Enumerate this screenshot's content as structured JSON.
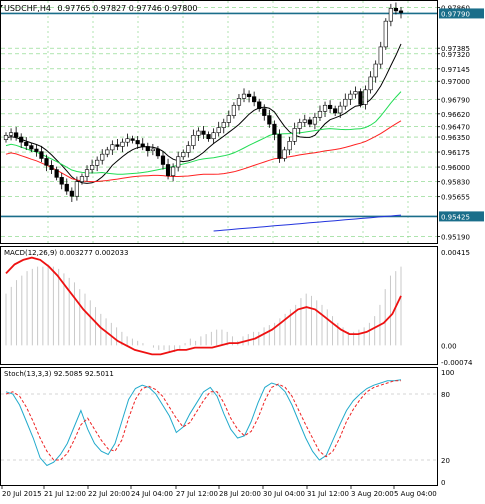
{
  "header": {
    "symbol_timeframe": "USDCHF,H4",
    "ohlc": "0.97765 0.97827 0.97746 0.97800"
  },
  "price_axis": {
    "ticks": [
      "0.97860",
      "0.97790",
      "0.97385",
      "0.97320",
      "0.97145",
      "0.97000",
      "0.96790",
      "0.96620",
      "0.96470",
      "0.96350",
      "0.96175",
      "0.96000",
      "0.95830",
      "0.95655",
      "0.95425",
      "0.95190"
    ],
    "highlighted": [
      {
        "label": "0.97790",
        "color": "#1a6e8a"
      },
      {
        "label": "0.95425",
        "color": "#1a6e8a"
      }
    ]
  },
  "macd": {
    "label": "MACD(12,26,9) 0.003277 0.002033",
    "ticks": [
      "0.00415",
      "0.00",
      "-0.00074"
    ],
    "histogram": [
      0.0023,
      0.0026,
      0.0029,
      0.0031,
      0.0033,
      0.0034,
      0.0035,
      0.0035,
      0.0036,
      0.0035,
      0.0034,
      0.0032,
      0.003,
      0.0028,
      0.0025,
      0.0023,
      0.002,
      0.0017,
      0.0014,
      0.0012,
      0.001,
      0.0008,
      0.0006,
      0.0004,
      0.0003,
      0.0002,
      0.0001,
      0.0,
      -0.0001,
      -0.0002,
      -0.0002,
      -0.0003,
      -0.0003,
      -0.0002,
      0.0001,
      0.0003,
      0.0002,
      0.0004,
      0.0005,
      0.0006,
      0.0007,
      0.0007,
      0.0006,
      0.0004,
      0.0002,
      0.0004,
      0.0005,
      0.0006,
      0.0006,
      0.0008,
      0.0009,
      0.001,
      0.0012,
      0.0014,
      0.0016,
      0.0018,
      0.0021,
      0.0023,
      0.0022,
      0.002,
      0.0018,
      0.0016,
      0.0013,
      0.001,
      0.0008,
      0.0006,
      0.0006,
      0.0007,
      0.0008,
      0.001,
      0.0013,
      0.0018,
      0.0025,
      0.0031,
      0.0033,
      0.0035
    ],
    "signal": [
      0.0032,
      0.0036,
      0.0038,
      0.0039,
      0.0038,
      0.0035,
      0.0031,
      0.0026,
      0.0021,
      0.0016,
      0.0012,
      0.0008,
      0.0005,
      0.0002,
      0.0,
      -0.0002,
      -0.0003,
      -0.0004,
      -0.0004,
      -0.0003,
      -0.0002,
      -0.0002,
      -0.0001,
      -0.0001,
      -0.0001,
      0.0,
      0.0001,
      0.0001,
      0.0002,
      0.0003,
      0.0005,
      0.0007,
      0.001,
      0.0013,
      0.0016,
      0.0017,
      0.0016,
      0.0013,
      0.001,
      0.0007,
      0.0005,
      0.0005,
      0.0006,
      0.0008,
      0.001,
      0.0014,
      0.0022
    ]
  },
  "stoch": {
    "label": "Stoch(13,3,3) 92.5085 92.5011",
    "ticks": [
      "100",
      "80",
      "20",
      "0"
    ],
    "main": [
      82,
      80,
      70,
      55,
      40,
      22,
      15,
      18,
      25,
      35,
      50,
      65,
      48,
      35,
      28,
      25,
      35,
      55,
      75,
      85,
      88,
      86,
      80,
      70,
      60,
      45,
      50,
      62,
      72,
      82,
      86,
      78,
      62,
      48,
      40,
      42,
      55,
      72,
      86,
      90,
      88,
      82,
      70,
      55,
      40,
      28,
      20,
      24,
      38,
      52,
      65,
      74,
      80,
      85,
      88,
      90,
      92,
      92,
      93
    ],
    "signal": [
      80,
      82,
      78,
      68,
      55,
      40,
      28,
      20,
      20,
      26,
      38,
      52,
      58,
      48,
      38,
      30,
      28,
      38,
      58,
      75,
      85,
      87,
      84,
      78,
      68,
      58,
      50,
      54,
      64,
      74,
      82,
      82,
      72,
      58,
      48,
      42,
      46,
      58,
      74,
      86,
      89,
      86,
      78,
      65,
      52,
      40,
      28,
      23,
      28,
      40,
      55,
      66,
      75,
      82,
      86,
      88,
      90,
      92,
      92
    ]
  },
  "time_axis": {
    "labels": [
      "20 Jul 2015",
      "21 Jul 12:00",
      "22 Jul 20:00",
      "24 Jul 04:00",
      "27 Jul 12:00",
      "28 Jul 20:00",
      "30 Jul 04:00",
      "31 Jul 12:00",
      "3 Aug 20:00",
      "5 Aug 04:00"
    ]
  },
  "colors": {
    "bull": "#ffffff",
    "bear": "#000000",
    "ma_fast": "#000000",
    "ma_mid": "#22dd55",
    "ma_slow": "#ff2222",
    "ma_long": "#2233dd",
    "macd_signal": "#ee1111",
    "stoch_main": "#22aacc",
    "stoch_signal": "#ee2222",
    "grid": "#7fd47f"
  }
}
